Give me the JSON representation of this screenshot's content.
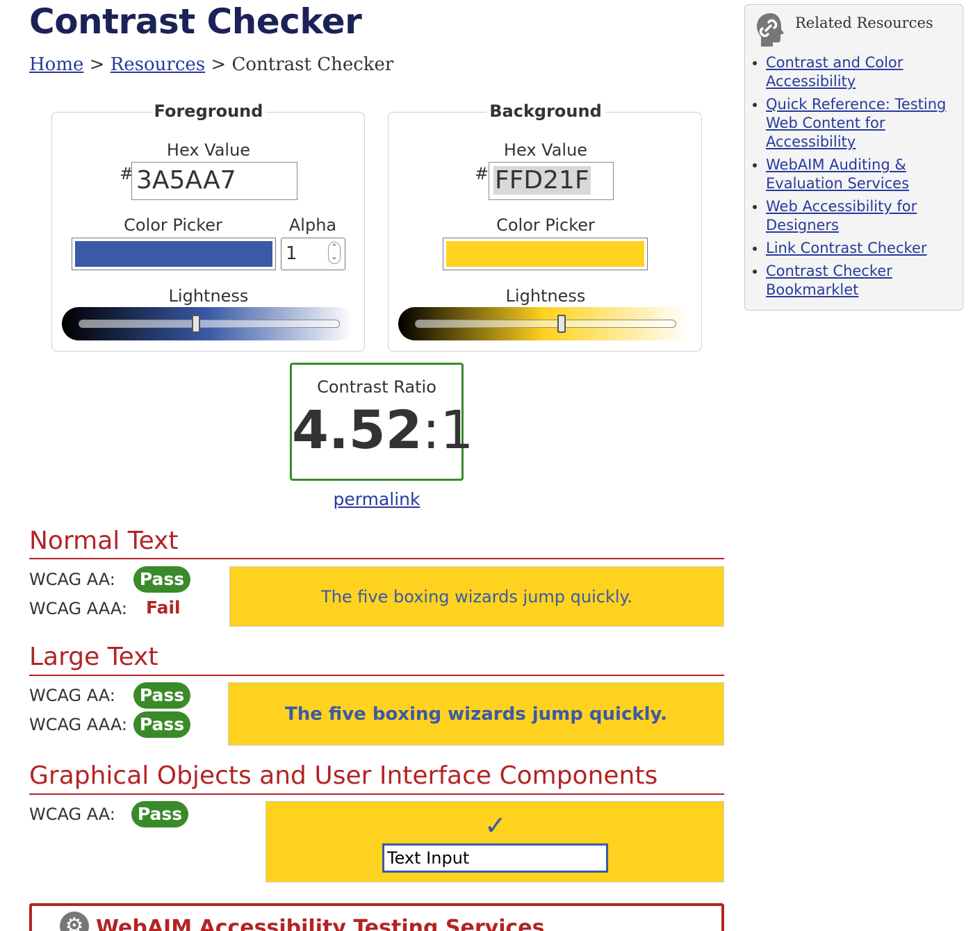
{
  "title": "Contrast Checker",
  "breadcrumb": {
    "home": "Home",
    "sep1": ">",
    "resources": "Resources",
    "sep2": ">",
    "current": "Contrast Checker"
  },
  "foreground": {
    "legend": "Foreground",
    "hex_label": "Hex Value",
    "hash": "#",
    "hex_value": "3A5AA7",
    "color": "#3A5AA7",
    "picker_label": "Color Picker",
    "alpha_label": "Alpha",
    "alpha_value": "1",
    "lightness_label": "Lightness",
    "lightness_level": 0.45
  },
  "background": {
    "legend": "Background",
    "hex_label": "Hex Value",
    "hash": "#",
    "hex_value": "FFD21F",
    "color": "#FFD21F",
    "picker_label": "Color Picker",
    "lightness_label": "Lightness",
    "lightness_level": 0.56
  },
  "ratio": {
    "label": "Contrast Ratio",
    "value_main": "4.52",
    "value_sep": ":",
    "value_tail": "1",
    "permalink": "permalink"
  },
  "normal_text": {
    "heading": "Normal Text",
    "aa_label": "WCAG AA:",
    "aa_result": "Pass",
    "aaa_label": "WCAG AAA:",
    "aaa_result": "Fail",
    "sample": "The five boxing wizards jump quickly."
  },
  "large_text": {
    "heading": "Large Text",
    "aa_label": "WCAG AA:",
    "aa_result": "Pass",
    "aaa_label": "WCAG AAA:",
    "aaa_result": "Pass",
    "sample": "The five boxing wizards jump quickly."
  },
  "graphical": {
    "heading": "Graphical Objects and User Interface Components",
    "aa_label": "WCAG AA:",
    "aa_result": "Pass",
    "check": "✓",
    "input_text": "Text Input"
  },
  "sidebar": {
    "title": "Related Resources",
    "links": [
      "Contrast and Color Accessibility",
      "Quick Reference: Testing Web Content for Accessibility",
      "WebAIM Auditing & Evaluation Services",
      "Web Accessibility for Designers",
      "Link Contrast Checker",
      "Contrast Checker Bookmarklet"
    ]
  },
  "banner": {
    "text": "WebAIM Accessibility Testing Services"
  },
  "colors": {
    "heading_red": "#b32424",
    "pass_green": "#3a8a2a",
    "link_blue": "#273a9b",
    "title_navy": "#1c2258"
  }
}
